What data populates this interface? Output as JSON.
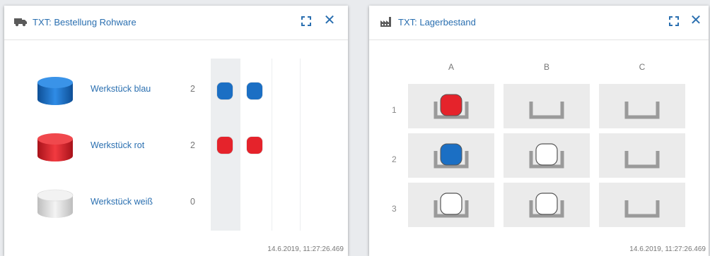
{
  "order_panel": {
    "title": "TXT: Bestellung Rohware",
    "header_icon": "truck-icon",
    "items": [
      {
        "label": "Werkstück blau",
        "count": "2",
        "color": "blue",
        "hex": "#1b6fc4"
      },
      {
        "label": "Werkstück rot",
        "count": "2",
        "color": "red",
        "hex": "#e5232b"
      },
      {
        "label": "Werkstück weiß",
        "count": "0",
        "color": "white",
        "hex": "#e8e8e8"
      }
    ],
    "timestamp": "14.6.2019, 11:27:26.469"
  },
  "stock_panel": {
    "title": "TXT: Lagerbestand",
    "header_icon": "factory-icon",
    "columns": [
      "A",
      "B",
      "C"
    ],
    "rows": [
      "1",
      "2",
      "3"
    ],
    "grid": [
      [
        "red",
        "empty",
        "empty"
      ],
      [
        "blue",
        "white",
        "empty"
      ],
      [
        "white",
        "white",
        "empty"
      ]
    ],
    "timestamp": "14.6.2019, 11:27:26.469"
  },
  "colors": {
    "accent": "#2a6fb0",
    "blue": "#1b6fc4",
    "red": "#e5232b",
    "white": "#ffffff",
    "tray": "#9a9a9a",
    "cell_bg": "#ebebeb"
  }
}
